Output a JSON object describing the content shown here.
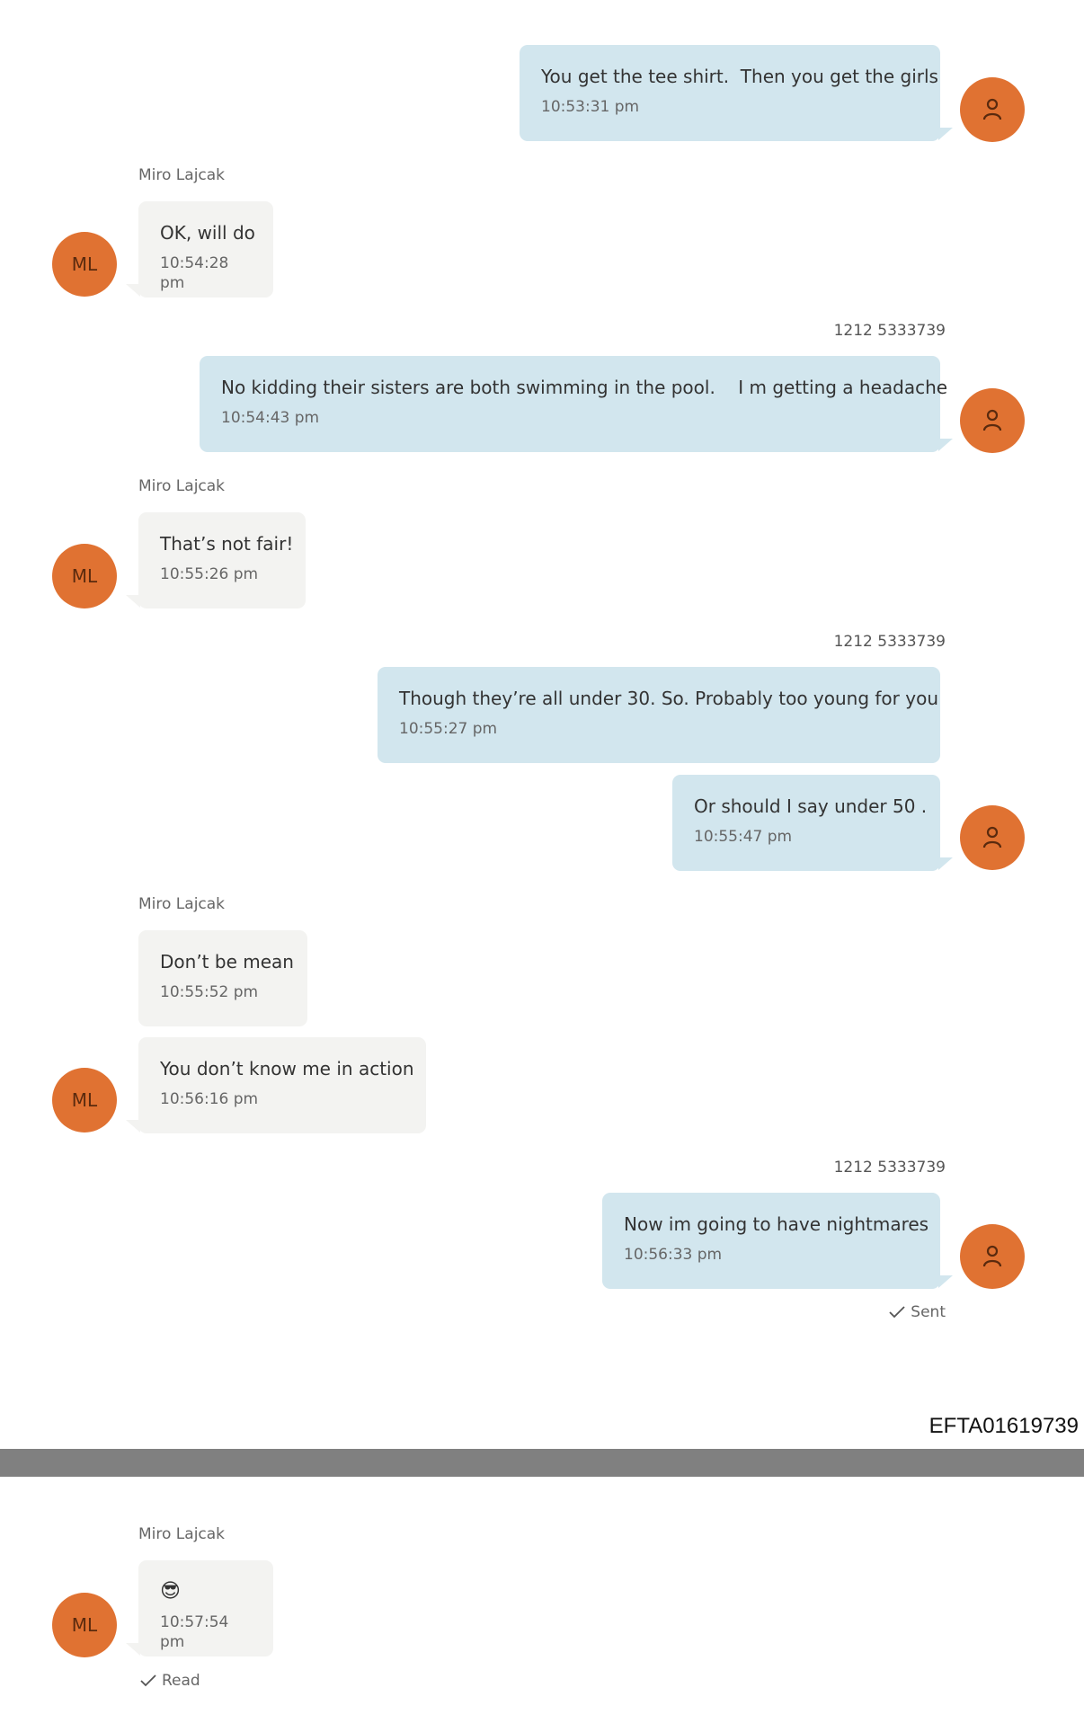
{
  "contact_name": "Miro Lajcak",
  "contact_initials": "ML",
  "self_number": "1212 5333739",
  "colors": {
    "avatar": "#e07232",
    "outgoing_bubble": "#d2e6ee",
    "incoming_bubble": "#f3f3f1",
    "divider": "#808080"
  },
  "messages": [
    {
      "text": "You get the tee shirt.  Then you get the girls",
      "time": "10:53:31 pm"
    },
    {
      "text": "OK, will do",
      "time": "10:54:28 pm"
    },
    {
      "text": "No kidding their sisters are both swimming in the pool.    I m getting a headache",
      "time": "10:54:43 pm"
    },
    {
      "text": "That’s not fair!",
      "time": "10:55:26 pm"
    },
    {
      "text": "Though they’re all under 30. So. Probably too young for you",
      "time": "10:55:27 pm"
    },
    {
      "text": "Or should I say under 50 .",
      "time": "10:55:47 pm"
    },
    {
      "text": "Don’t be mean",
      "time": "10:55:52 pm"
    },
    {
      "text": "You don’t know me in action",
      "time": "10:56:16 pm"
    },
    {
      "text": "Now im going to have nightmares",
      "time": "10:56:33 pm"
    },
    {
      "text": "😎",
      "time": "10:57:54 pm"
    }
  ],
  "status_sent": "Sent",
  "status_read": "Read",
  "document_id": "EFTA01619739",
  "icons": {
    "self_avatar": "person-icon",
    "status": "checkmark-icon"
  }
}
